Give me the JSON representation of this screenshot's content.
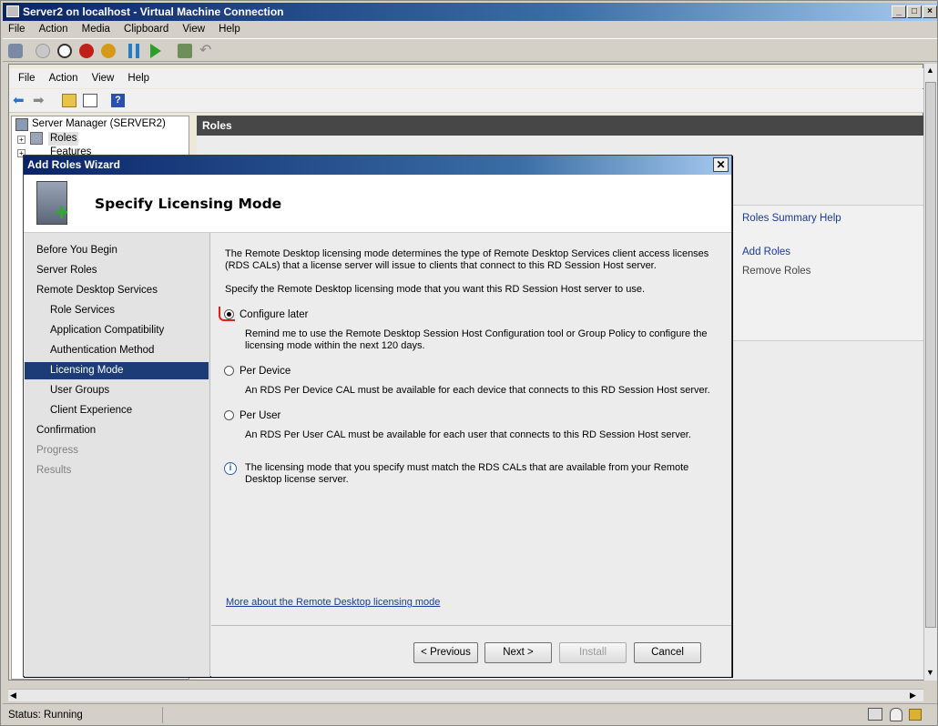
{
  "window": {
    "title": "Server2 on localhost - Virtual Machine Connection",
    "menu": [
      "File",
      "Action",
      "Media",
      "Clipboard",
      "View",
      "Help"
    ]
  },
  "inner": {
    "menu": [
      "File",
      "Action",
      "View",
      "Help"
    ],
    "tree": {
      "root": "Server Manager (SERVER2)",
      "items": [
        "Roles",
        "Features"
      ]
    },
    "roles_header": "Roles",
    "actions": [
      "Roles Summary Help",
      "Add Roles",
      "Remove Roles"
    ]
  },
  "dialog": {
    "title": "Add Roles Wizard",
    "heading": "Specify Licensing Mode",
    "nav": [
      {
        "label": "Before You Begin",
        "level": 0,
        "state": "normal"
      },
      {
        "label": "Server Roles",
        "level": 0,
        "state": "normal"
      },
      {
        "label": "Remote Desktop Services",
        "level": 0,
        "state": "normal"
      },
      {
        "label": "Role Services",
        "level": 1,
        "state": "normal"
      },
      {
        "label": "Application Compatibility",
        "level": 1,
        "state": "normal"
      },
      {
        "label": "Authentication Method",
        "level": 1,
        "state": "normal"
      },
      {
        "label": "Licensing Mode",
        "level": 1,
        "state": "selected"
      },
      {
        "label": "User Groups",
        "level": 1,
        "state": "normal"
      },
      {
        "label": "Client Experience",
        "level": 1,
        "state": "normal"
      },
      {
        "label": "Confirmation",
        "level": 0,
        "state": "normal"
      },
      {
        "label": "Progress",
        "level": 0,
        "state": "disabled"
      },
      {
        "label": "Results",
        "level": 0,
        "state": "disabled"
      }
    ],
    "intro_line1": "The Remote Desktop licensing mode determines the type of Remote Desktop Services client access licenses",
    "intro_line2": "(RDS CALs) that a license server will issue to clients that connect to this RD Session Host server.",
    "specify": "Specify the Remote Desktop licensing mode that you want this RD Session Host server to use.",
    "options": [
      {
        "label": "Configure later",
        "checked": true,
        "desc1": "Remind me to use the Remote Desktop Session Host Configuration tool or Group Policy to configure the",
        "desc2": "licensing mode within the next 120 days."
      },
      {
        "label": "Per Device",
        "checked": false,
        "desc1": "An RDS Per Device CAL must be available for each device that connects to this RD Session Host server.",
        "desc2": ""
      },
      {
        "label": "Per User",
        "checked": false,
        "desc1": "An RDS Per User CAL must be available for each user that connects to this RD Session Host server.",
        "desc2": ""
      }
    ],
    "info1": "The licensing mode that you specify must match the RDS CALs that are available from your Remote",
    "info2": "Desktop license server.",
    "more_link": "More about the Remote Desktop licensing mode",
    "buttons": {
      "previous": "< Previous",
      "next": "Next >",
      "install": "Install",
      "cancel": "Cancel"
    }
  },
  "status": "Status: Running"
}
